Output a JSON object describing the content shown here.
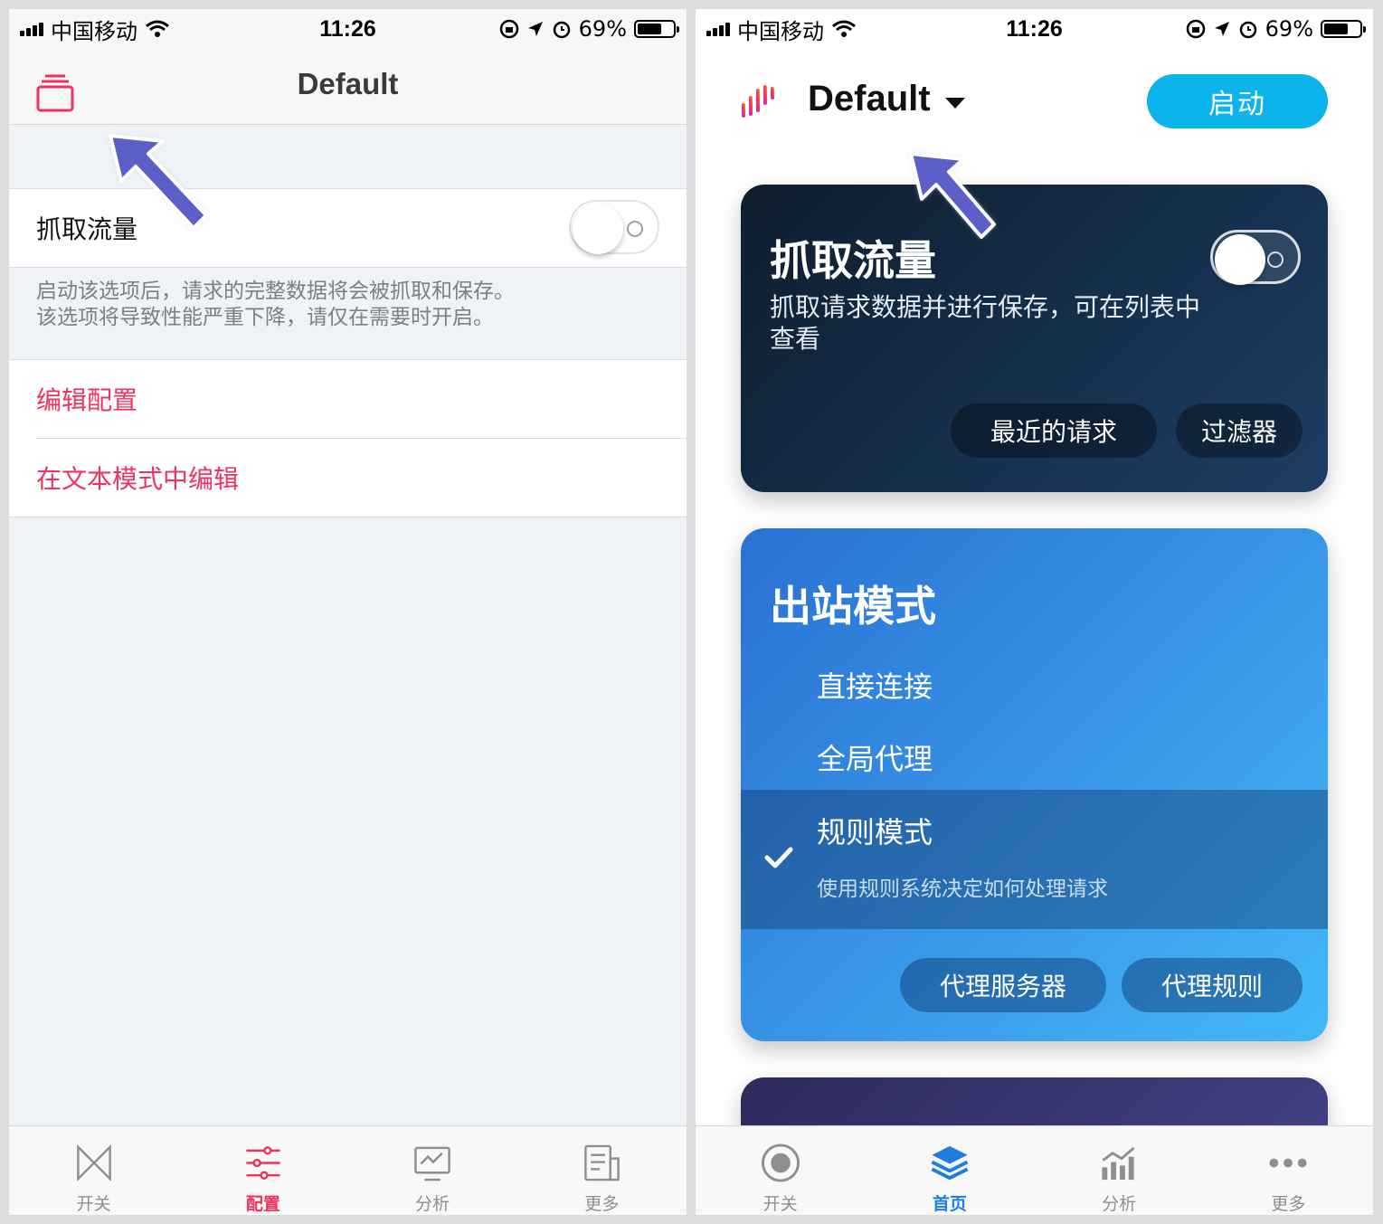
{
  "status_bar": {
    "carrier": "中国移动",
    "time": "11:26",
    "battery": "69%",
    "battery_level": 0.69
  },
  "left": {
    "nav_title": "Default",
    "capture_label": "抓取流量",
    "capture_enabled": false,
    "footnote_line1": "启动该选项后，请求的完整数据将会被抓取和保存。",
    "footnote_line2": "该选项将导致性能严重下降，请仅在需要时开启。",
    "edit_config": "编辑配置",
    "edit_text_mode": "在文本模式中编辑",
    "tabs": [
      {
        "label": "开关",
        "icon": "switch-icon",
        "active": false
      },
      {
        "label": "配置",
        "icon": "sliders-icon",
        "active": true
      },
      {
        "label": "分析",
        "icon": "monitor-chart-icon",
        "active": false
      },
      {
        "label": "更多",
        "icon": "document-icon",
        "active": false
      }
    ]
  },
  "right": {
    "profile_title": "Default",
    "start_button": "启动",
    "capture_card": {
      "title": "抓取流量",
      "description": "抓取请求数据并进行保存，可在列表中查看",
      "enabled": false,
      "recent_requests": "最近的请求",
      "filters": "过滤器"
    },
    "outbound_card": {
      "title": "出站模式",
      "modes": [
        {
          "label": "直接连接",
          "selected": false
        },
        {
          "label": "全局代理",
          "selected": false
        },
        {
          "label": "规则模式",
          "selected": true,
          "subtitle": "使用规则系统决定如何处理请求"
        }
      ],
      "proxy_servers": "代理服务器",
      "proxy_rules": "代理规则"
    },
    "tabs": [
      {
        "label": "开关",
        "icon": "record-icon",
        "active": false
      },
      {
        "label": "首页",
        "icon": "layers-icon",
        "active": true
      },
      {
        "label": "分析",
        "icon": "bar-chart-icon",
        "active": false
      },
      {
        "label": "更多",
        "icon": "more-dots-icon",
        "active": false
      }
    ]
  },
  "colors": {
    "accent_red": "#f0325f",
    "accent_blue": "#1f7de2",
    "start_button": "#0bb4ec",
    "annotation_arrow": "#5b5fc7"
  }
}
